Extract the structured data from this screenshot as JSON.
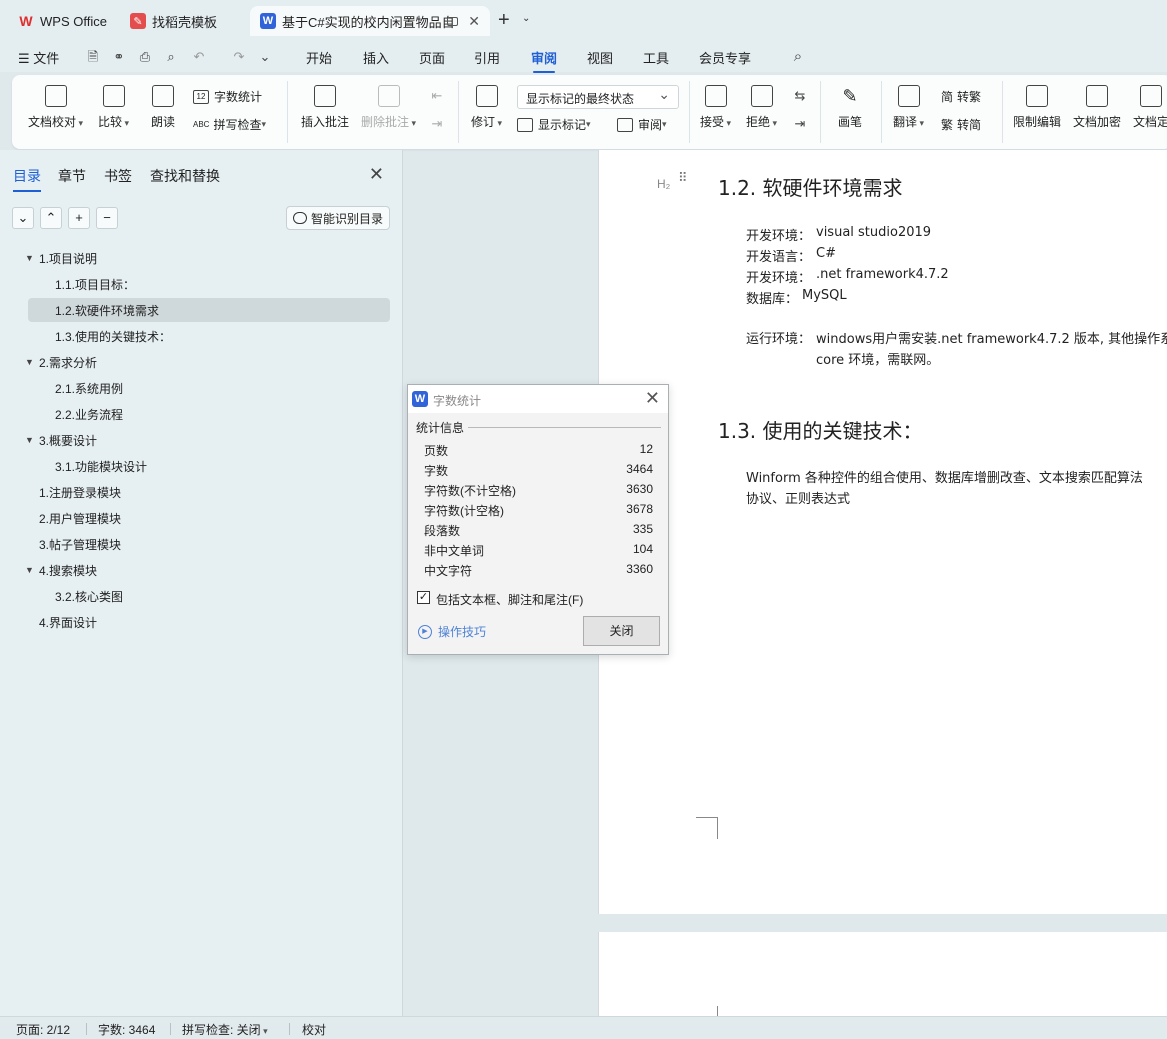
{
  "tabs": [
    {
      "label": "WPS Office"
    },
    {
      "label": "找稻壳模板"
    },
    {
      "label": "基于C#实现的校内闲置物品自"
    }
  ],
  "menu": {
    "file": "文件",
    "items": [
      "开始",
      "插入",
      "页面",
      "引用",
      "审阅",
      "视图",
      "工具",
      "会员专享"
    ],
    "active": "审阅"
  },
  "ribbon": {
    "proofread": "文档校对",
    "compare": "比较",
    "read_aloud": "朗读",
    "word_count": "字数统计",
    "spell_check": "拼写检查",
    "insert_comment": "插入批注",
    "delete_comment": "删除批注",
    "revise": "修订",
    "markup_state": "显示标记的最终状态",
    "show_markup": "显示标记",
    "review": "审阅",
    "accept": "接受",
    "reject": "拒绝",
    "pen": "画笔",
    "translate": "翻译",
    "to_traditional": "转繁",
    "to_simplified": "转简",
    "restrict_edit": "限制编辑",
    "encrypt": "文档加密",
    "finalize": "文档定"
  },
  "nav": {
    "tabs": [
      "目录",
      "章节",
      "书签",
      "查找和替换"
    ],
    "smart_toc": "智能识别目录",
    "toc": [
      {
        "label": "1.项目说明",
        "level": 1,
        "expandable": true
      },
      {
        "label": "1.1.项目目标：",
        "level": 2
      },
      {
        "label": "1.2.软硬件环境需求",
        "level": 2,
        "selected": true
      },
      {
        "label": "1.3.使用的关键技术：",
        "level": 2
      },
      {
        "label": "2.需求分析",
        "level": 1,
        "expandable": true
      },
      {
        "label": "2.1.系统用例",
        "level": 2
      },
      {
        "label": "2.2.业务流程",
        "level": 2
      },
      {
        "label": "3.概要设计",
        "level": 1,
        "expandable": true
      },
      {
        "label": "3.1.功能模块设计",
        "level": 2
      },
      {
        "label": "1.注册登录模块",
        "level": 1
      },
      {
        "label": "2.用户管理模块",
        "level": 1
      },
      {
        "label": "3.帖子管理模块",
        "level": 1
      },
      {
        "label": "4.搜索模块",
        "level": 1,
        "expandable": true
      },
      {
        "label": "3.2.核心类图",
        "level": 2
      },
      {
        "label": "4.界面设计",
        "level": 1
      }
    ]
  },
  "doc": {
    "heading_marker": "H₂",
    "h12": "1.2. 软硬件环境需求",
    "env_lines": [
      {
        "label": "开发环境：",
        "value": "visual studio2019"
      },
      {
        "label": "开发语言：",
        "value": "C#"
      },
      {
        "label": "开发环境：",
        "value": ".net framework4.7.2"
      },
      {
        "label": "数据库：",
        "value": "MySQL"
      }
    ],
    "run_label": "运行环境：",
    "run_line1": "windows用户需安装.net framework4.7.2 版本, 其他操作系",
    "run_line2": "core 环境，需联网。",
    "h13": "1.3. 使用的关键技术：",
    "tech_line1": "Winform 各种控件的组合使用、数据库增删改查、文本搜索匹配算法",
    "tech_line2": "协议、正则表达式"
  },
  "dialog": {
    "title": "字数统计",
    "group": "统计信息",
    "stats": [
      {
        "label": "页数",
        "value": "12"
      },
      {
        "label": "字数",
        "value": "3464"
      },
      {
        "label": "字符数(不计空格)",
        "value": "3630"
      },
      {
        "label": "字符数(计空格)",
        "value": "3678"
      },
      {
        "label": "段落数",
        "value": "335"
      },
      {
        "label": "非中文单词",
        "value": "104"
      },
      {
        "label": "中文字符",
        "value": "3360"
      }
    ],
    "checkbox": "包括文本框、脚注和尾注(F)",
    "checked": true,
    "tips": "操作技巧",
    "close": "关闭"
  },
  "status": {
    "page": "页面: 2/12",
    "words": "字数: 3464",
    "spell": "拼写检查: 关闭",
    "proof": "校对"
  }
}
